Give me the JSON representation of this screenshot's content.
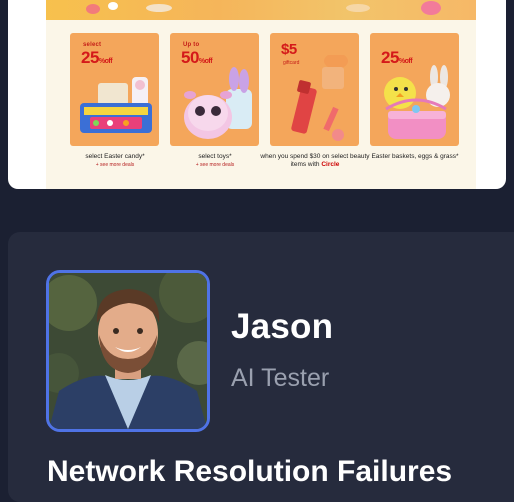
{
  "promo": {
    "offers": [
      {
        "lead": "select",
        "value": "25",
        "suffix": "%off",
        "caption": "select Easter candy*",
        "link": "+ see more deals",
        "art": "easter-candy-basket"
      },
      {
        "lead": "Up to",
        "value": "50",
        "suffix": "%off",
        "caption": "select toys*",
        "link": "+ see more deals",
        "art": "plush-bunny-toy"
      },
      {
        "lead": "$5",
        "value": "",
        "suffix": "",
        "sub": "giftcard",
        "caption": "when you spend $30 on select beauty items with",
        "caption_brand": "Circle",
        "art": "beauty-lipstick"
      },
      {
        "lead": "",
        "value": "25",
        "suffix": "%off",
        "caption": "Easter baskets, eggs & grass*",
        "art": "easter-basket-chick"
      }
    ],
    "colors": {
      "tile": "#f4a65b",
      "accent_red": "#d41a1a",
      "banner": "#f5b55a"
    }
  },
  "profile": {
    "name": "Jason",
    "role": "AI Tester",
    "avatar_icon": "person-photo",
    "frame_color": "#4f73e6"
  },
  "article": {
    "title": "Network Resolution Failures"
  }
}
